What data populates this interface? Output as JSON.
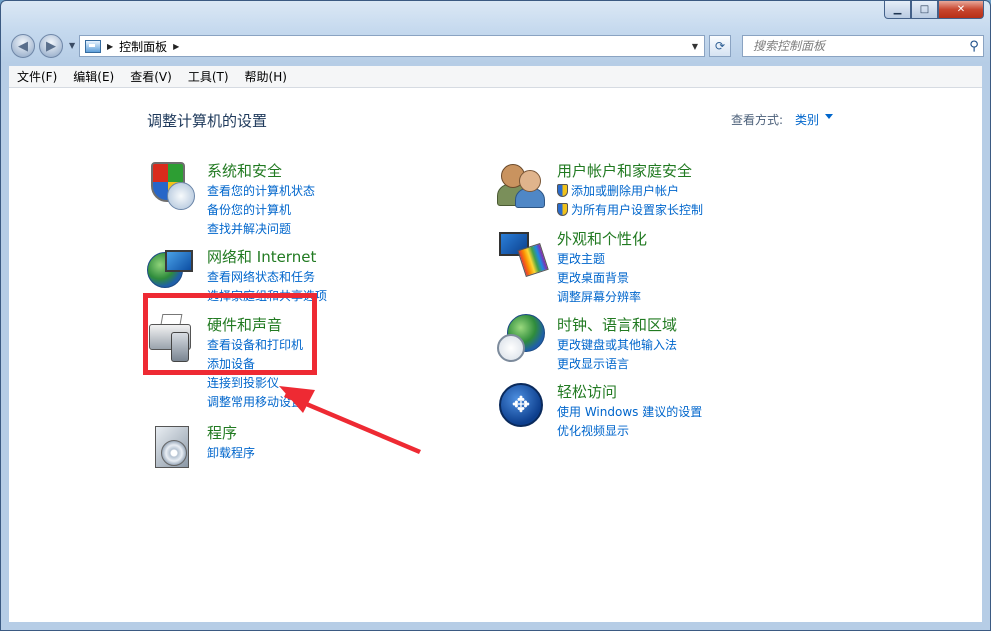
{
  "window": {
    "caption_min": "▁",
    "caption_max": "□",
    "caption_close": "✕"
  },
  "nav": {
    "back": "◀",
    "forward": "▶",
    "breadcrumb": "控制面板",
    "search_placeholder": "搜索控制面板"
  },
  "menu": [
    "文件(F)",
    "编辑(E)",
    "查看(V)",
    "工具(T)",
    "帮助(H)"
  ],
  "content": {
    "title": "调整计算机的设置",
    "view_by_label": "查看方式:",
    "view_by_value": "类别"
  },
  "categories": {
    "system": {
      "title": "系统和安全",
      "links": [
        "查看您的计算机状态",
        "备份您的计算机",
        "查找并解决问题"
      ]
    },
    "network": {
      "title": "网络和 Internet",
      "links": [
        "查看网络状态和任务",
        "选择家庭组和共享选项"
      ]
    },
    "hardware": {
      "title": "硬件和声音",
      "links": [
        "查看设备和打印机",
        "添加设备",
        "连接到投影仪",
        "调整常用移动设置"
      ]
    },
    "programs": {
      "title": "程序",
      "links": [
        "卸载程序"
      ]
    },
    "users": {
      "title": "用户帐户和家庭安全",
      "links": [
        "添加或删除用户帐户",
        "为所有用户设置家长控制"
      ]
    },
    "appearance": {
      "title": "外观和个性化",
      "links": [
        "更改主题",
        "更改桌面背景",
        "调整屏幕分辨率"
      ]
    },
    "clock": {
      "title": "时钟、语言和区域",
      "links": [
        "更改键盘或其他输入法",
        "更改显示语言"
      ]
    },
    "ease": {
      "title": "轻松访问",
      "links": [
        "使用 Windows 建议的设置",
        "优化视频显示"
      ]
    }
  },
  "annotation": {
    "highlight_color": "#ee2a33",
    "arrow_color": "#ee2a33"
  }
}
